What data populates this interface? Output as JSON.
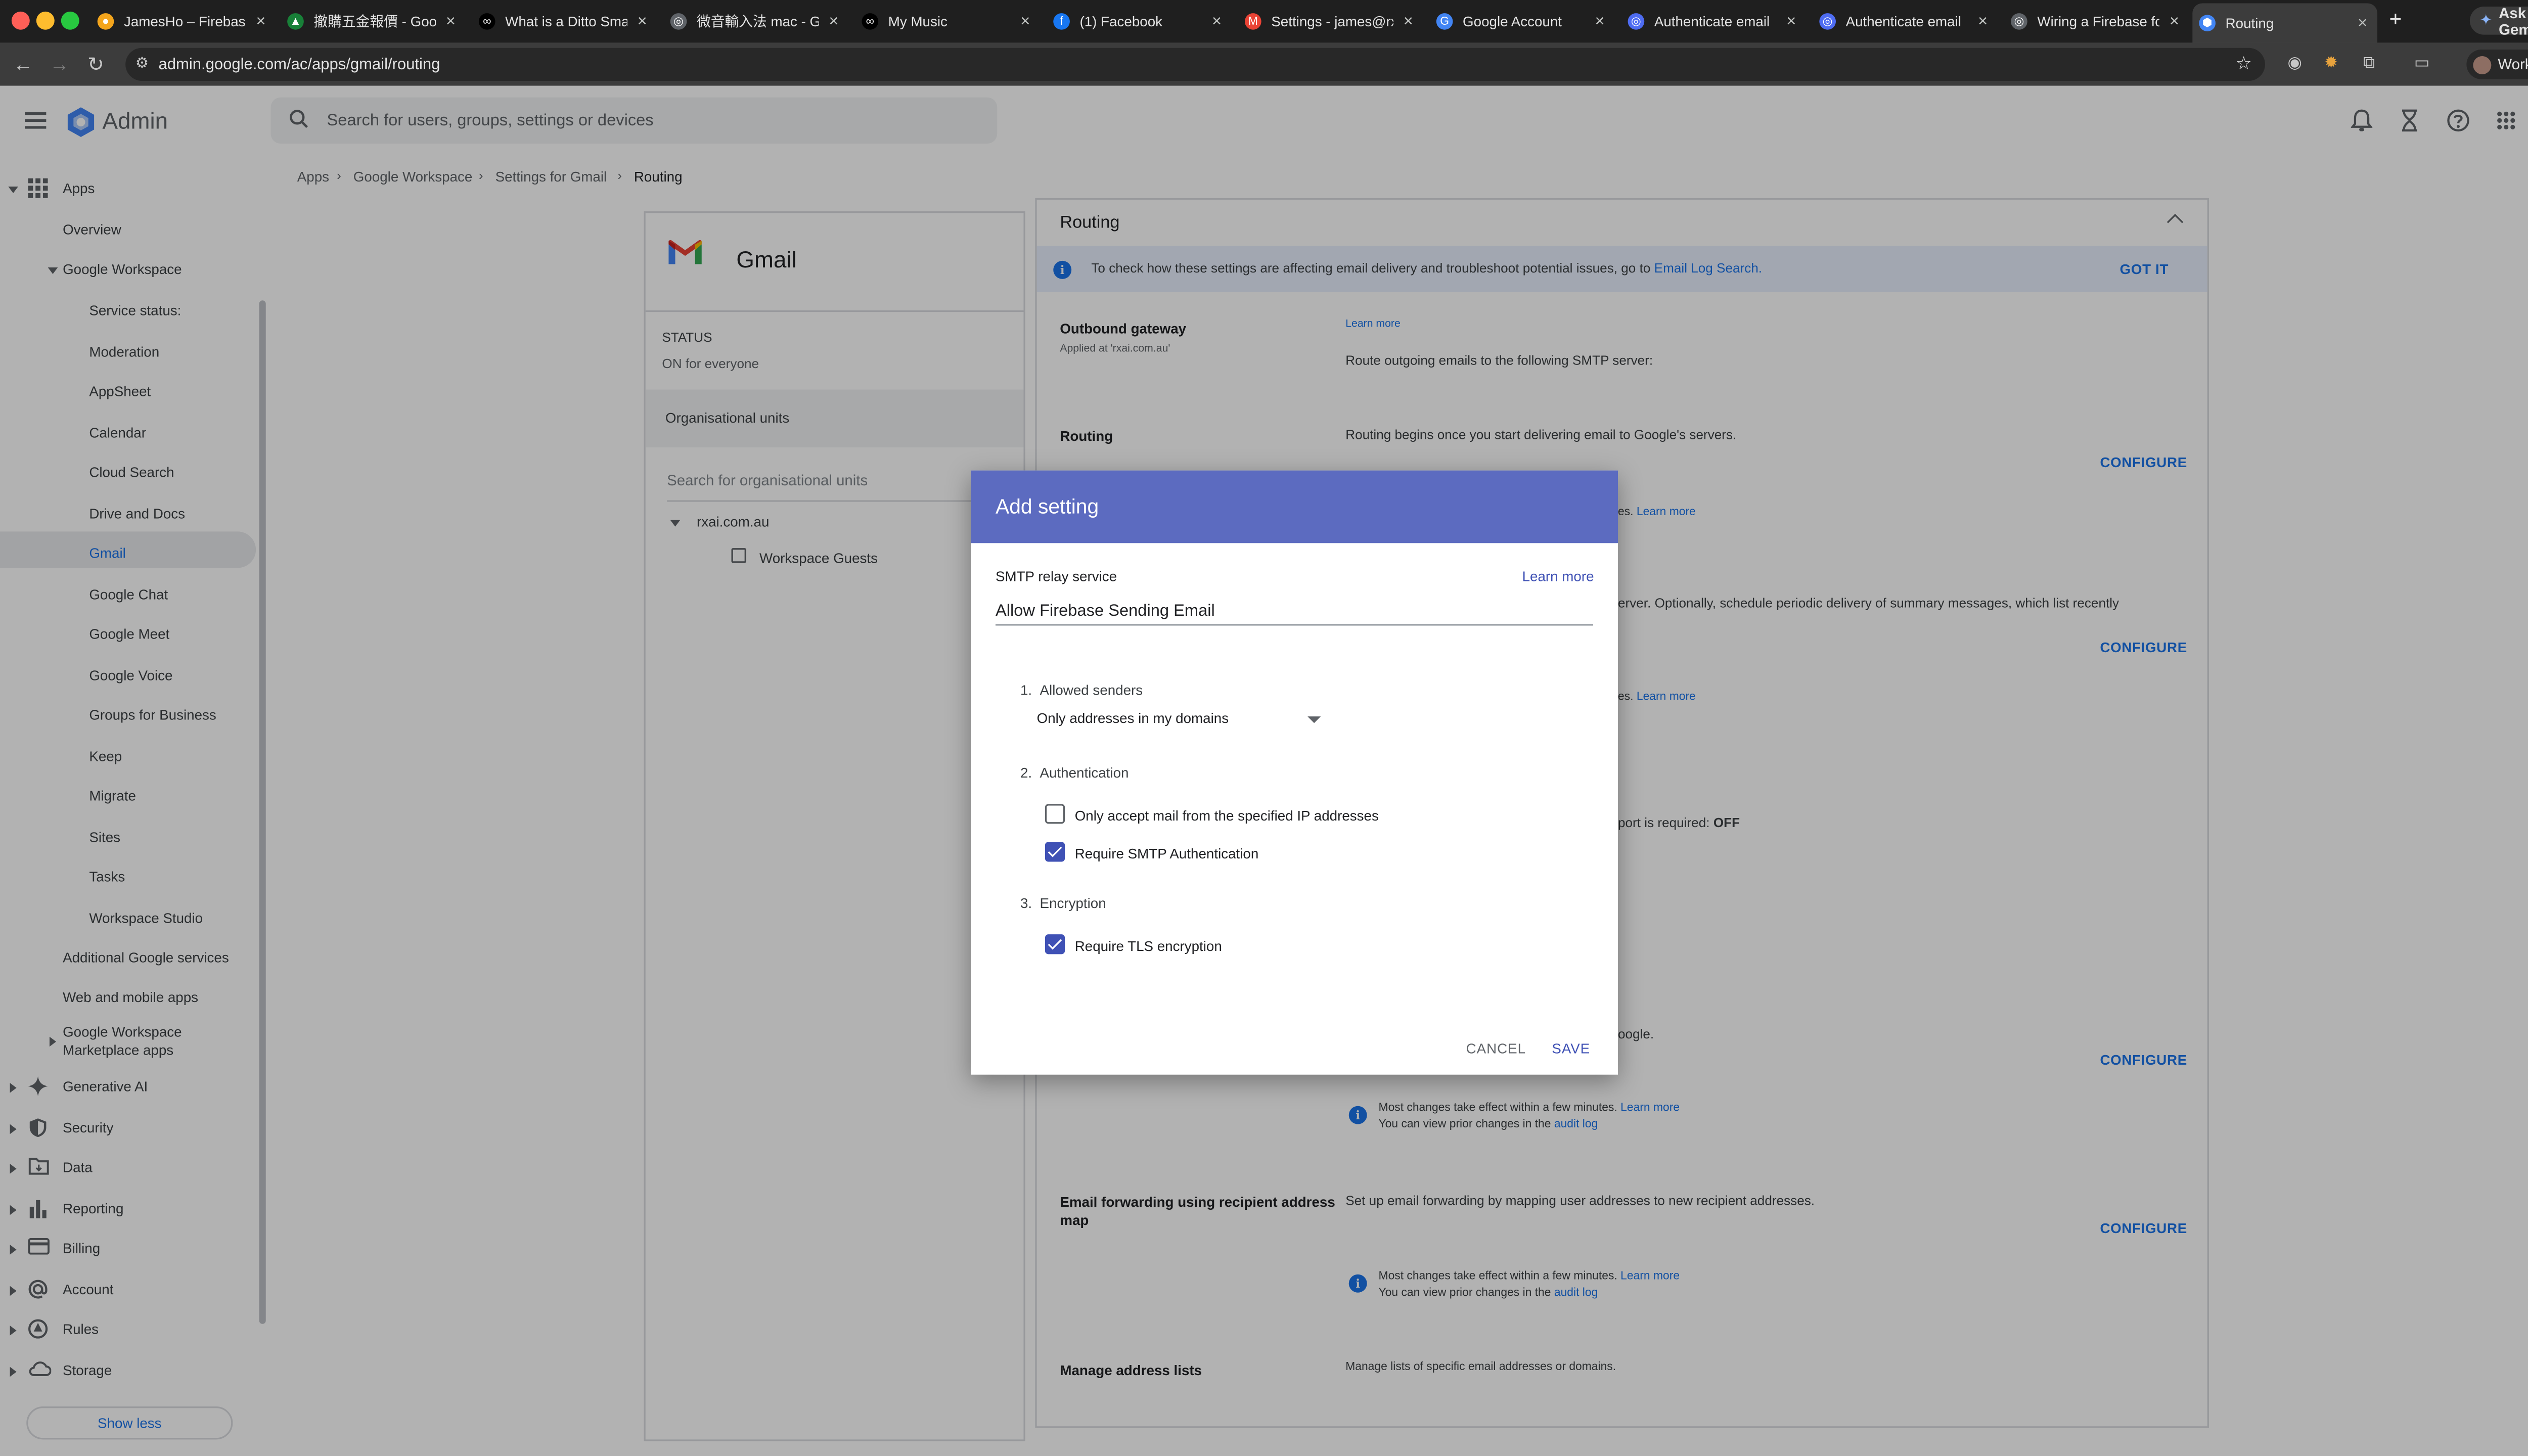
{
  "browser": {
    "tabs": [
      {
        "label": "JamesHo – Firebase",
        "color": "#f4a51c",
        "glyph": "●"
      },
      {
        "label": "撤購五金報價 - Goog",
        "color": "#188038",
        "glyph": "▲"
      },
      {
        "label": "What is a Ditto Smar",
        "color": "#000000",
        "glyph": "∞"
      },
      {
        "label": "微音輸入法 mac - Go",
        "color": "#5f6368",
        "glyph": "◎"
      },
      {
        "label": "My Music",
        "color": "#000000",
        "glyph": "∞"
      },
      {
        "label": "(1) Facebook",
        "color": "#1877f2",
        "glyph": "f"
      },
      {
        "label": "Settings - james@rx",
        "color": "#ea4335",
        "glyph": "M"
      },
      {
        "label": "Google Account",
        "color": "#4285f4",
        "glyph": "G"
      },
      {
        "label": "Authenticate email",
        "color": "#4e6cf2",
        "glyph": "◎"
      },
      {
        "label": "Authenticate email",
        "color": "#4e6cf2",
        "glyph": "◎"
      },
      {
        "label": "Wiring a Firebase fo",
        "color": "#5f6368",
        "glyph": "◎"
      },
      {
        "label": "Routing",
        "color": "#4285f4",
        "glyph": "⬢"
      }
    ],
    "ask_gemini": "Ask Gemini",
    "url": "admin.google.com/ac/apps/gmail/routing",
    "profile": "Work"
  },
  "header": {
    "app_name": "Admin",
    "search_placeholder": "Search for users, groups, settings or devices"
  },
  "breadcrumb": [
    "Apps",
    "Google Workspace",
    "Settings for Gmail",
    "Routing"
  ],
  "sidebar": {
    "apps": "Apps",
    "overview": "Overview",
    "google_workspace": "Google Workspace",
    "workspace_items": [
      "Service status:",
      "Moderation",
      "AppSheet",
      "Calendar",
      "Cloud Search",
      "Drive and Docs",
      "Gmail",
      "Google Chat",
      "Google Meet",
      "Google Voice",
      "Groups for Business",
      "Keep",
      "Migrate",
      "Sites",
      "Tasks",
      "Workspace Studio"
    ],
    "additional_services": "Additional Google services",
    "web_mobile": "Web and mobile apps",
    "marketplace_1": "Google Workspace",
    "marketplace_2": "Marketplace apps",
    "sections": [
      "Generative AI",
      "Security",
      "Data",
      "Reporting",
      "Billing",
      "Account",
      "Rules",
      "Storage"
    ],
    "show_less": "Show less"
  },
  "gmail_card": {
    "title": "Gmail",
    "status_label": "STATUS",
    "status_value": "ON for everyone",
    "org_units": "Organisational units",
    "org_search_placeholder": "Search for organisational units",
    "root_ou": "rxai.com.au",
    "child_ou": "Workspace Guests"
  },
  "routing_card": {
    "title": "Routing",
    "info_text": "To check how these settings are affecting email delivery and troubleshoot potential issues, go to",
    "info_link": "Email Log Search.",
    "got_it": "GOT IT",
    "outbound_label": "Outbound gateway",
    "outbound_applied": "Applied at 'rxai.com.au'",
    "learn_more": "Learn more",
    "outbound_desc": "Route outgoing emails to the following SMTP server:",
    "routing_label": "Routing",
    "routing_desc": "Routing begins once you start delivering email to Google's servers.",
    "configure": "CONFIGURE",
    "frag_1": "es.",
    "frag_2": "erver. Optionally, schedule periodic delivery of summary messages, which list recently",
    "frag_3": "es.",
    "frag_4": "port is required:",
    "frag_4_value": "OFF",
    "frag_5": "oogle.",
    "note_1": "Most changes take effect within a few minutes.",
    "note_2": "You can view prior changes in the",
    "audit_log": "audit log",
    "fwd_label_1": "Email forwarding using recipient address",
    "fwd_label_2": "map",
    "fwd_desc": "Set up email forwarding by mapping user addresses to new recipient addresses.",
    "addr_label": "Manage address lists",
    "addr_desc": "Manage lists of specific email addresses or domains."
  },
  "dialog": {
    "title": "Add setting",
    "service_label": "SMTP relay service",
    "learn_more": "Learn more",
    "name_value": "Allow Firebase Sending Email",
    "section_1": "Allowed senders",
    "senders_value": "Only addresses in my domains",
    "section_2": "Authentication",
    "auth_ip": "Only accept mail from the specified IP addresses",
    "auth_ip_checked": false,
    "auth_smtp": "Require SMTP Authentication",
    "auth_smtp_checked": true,
    "section_3": "Encryption",
    "tls": "Require TLS encryption",
    "tls_checked": true,
    "cancel": "CANCEL",
    "save": "SAVE"
  },
  "colors": {
    "accent": "#1a73e8",
    "dialog_header": "#5c6bc0",
    "checkbox": "#3f51b5"
  }
}
